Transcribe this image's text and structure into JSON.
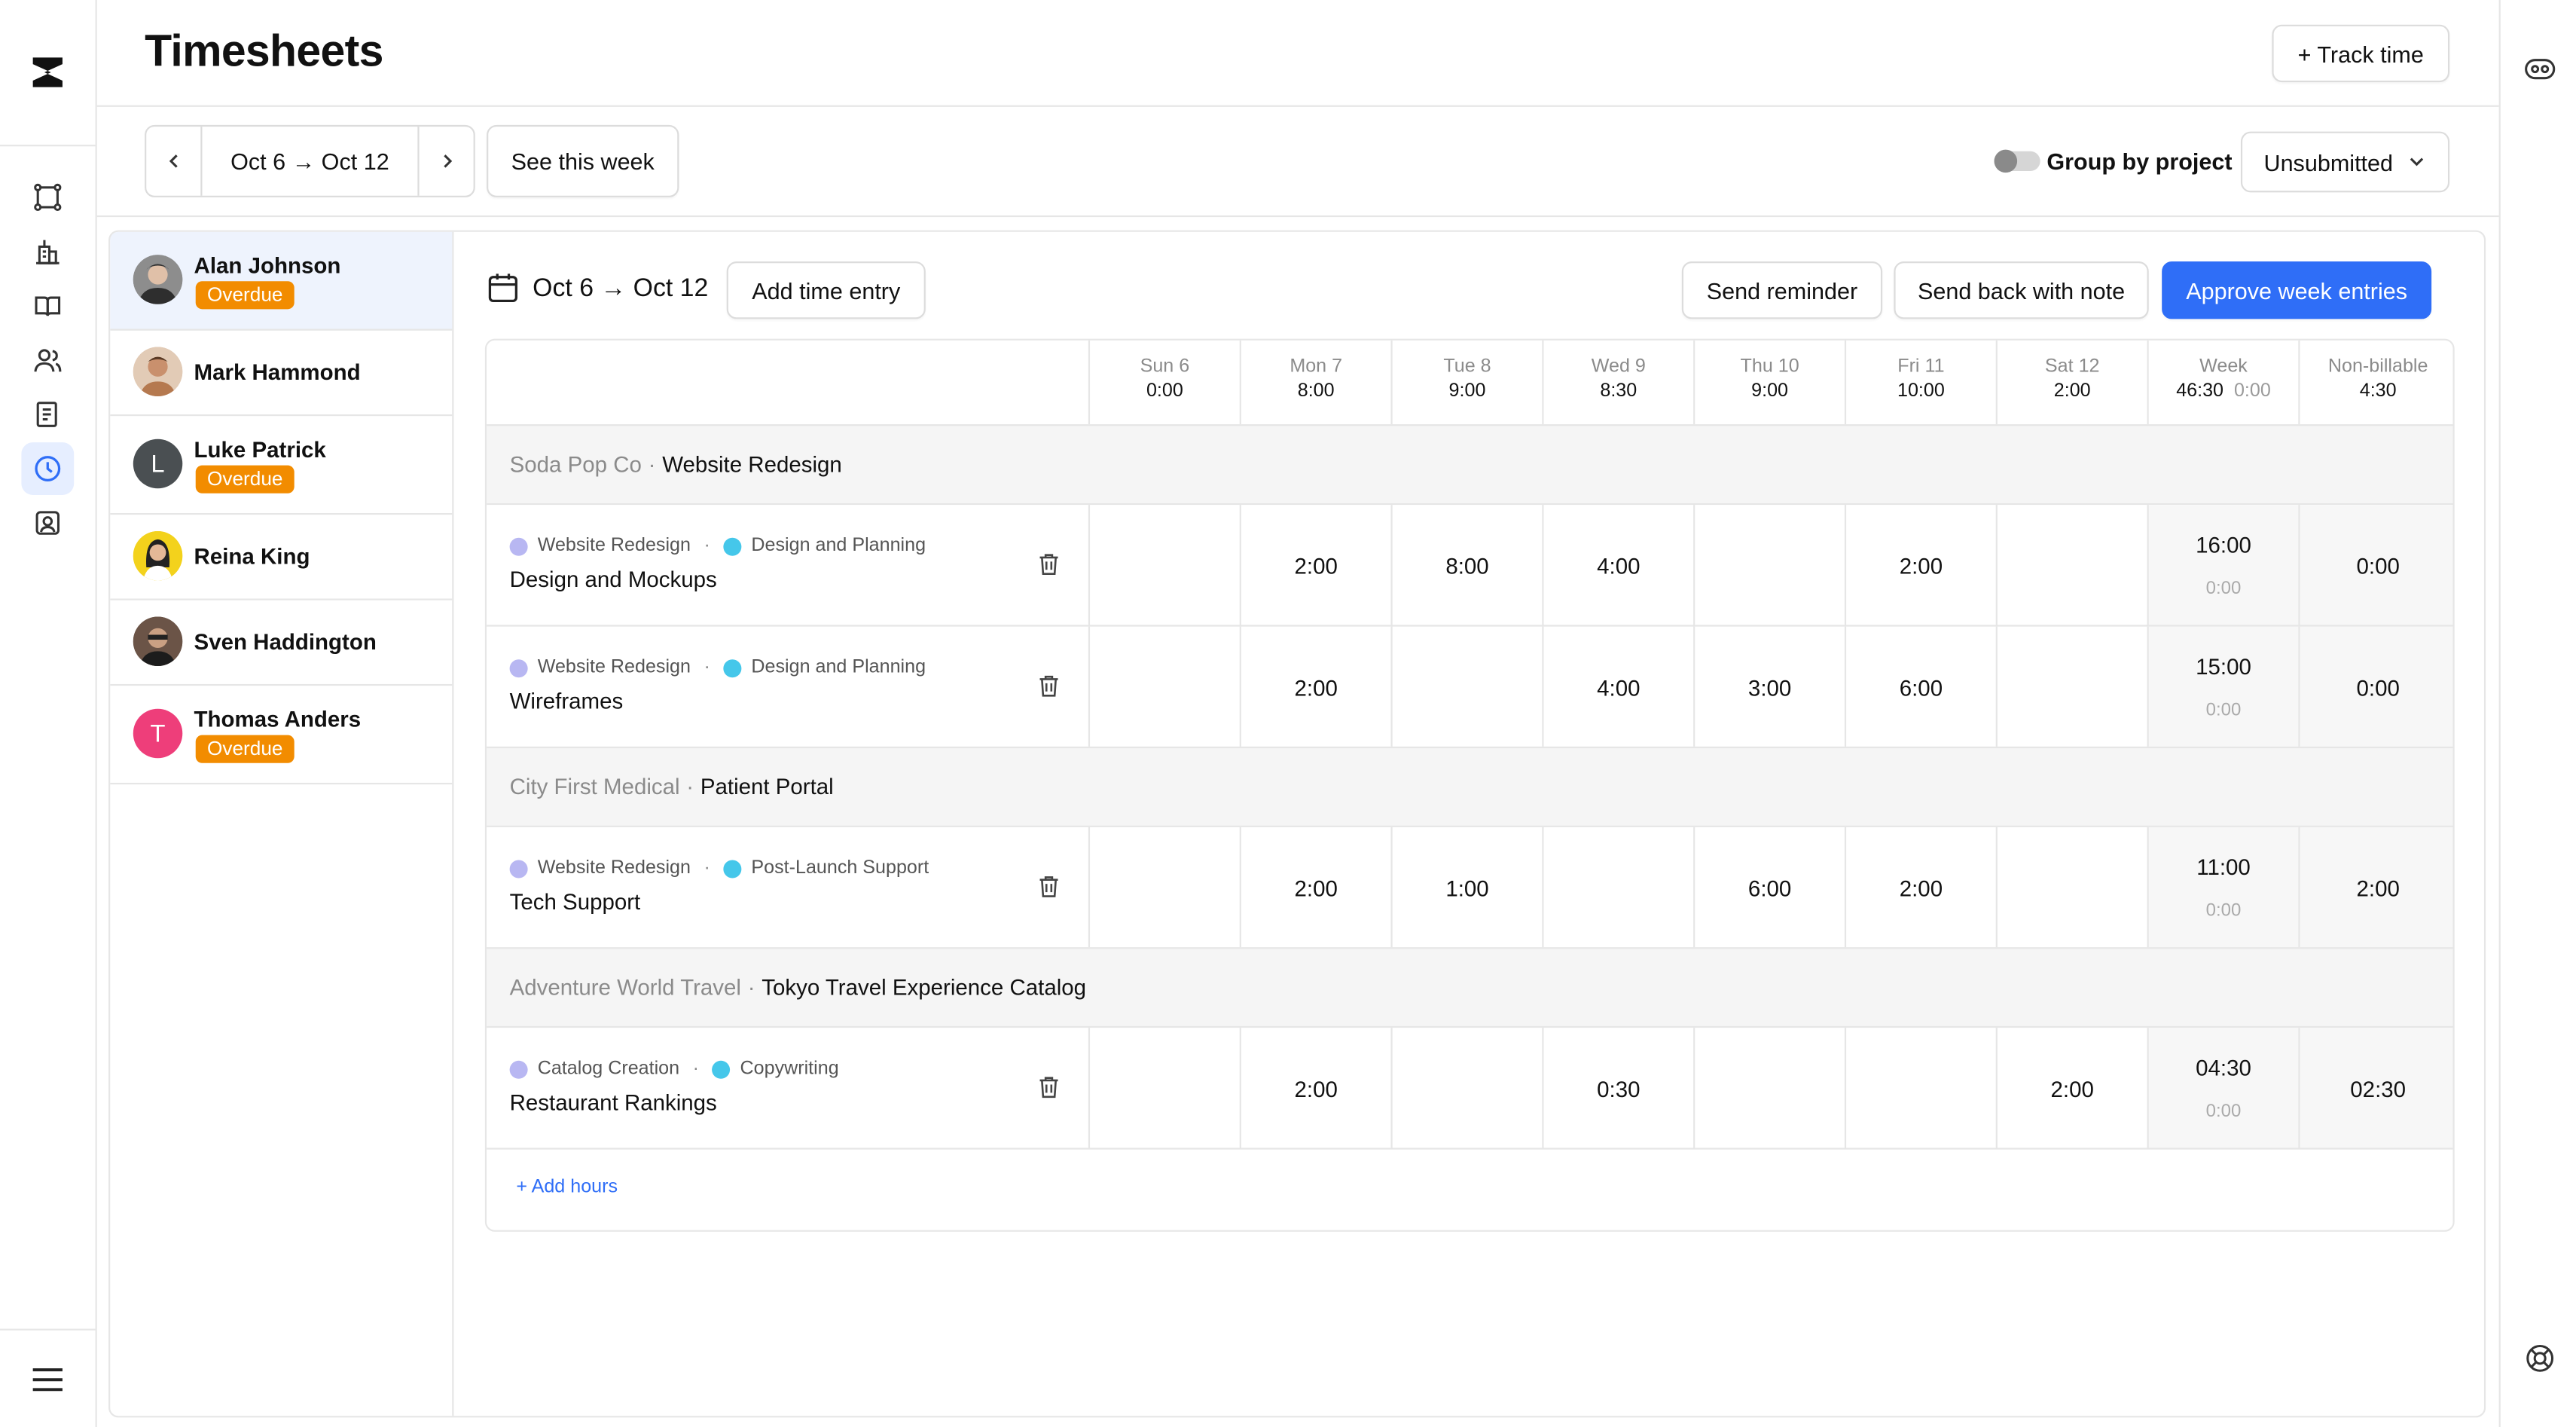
{
  "header": {
    "title": "Timesheets",
    "track_time_label": "+ Track time"
  },
  "filters": {
    "week_range": "Oct 6 → Oct 12",
    "see_this_week_label": "See this week",
    "group_by_project_label": "Group by project",
    "group_by_project_on": false,
    "status_selected": "Unsubmitted"
  },
  "people": [
    {
      "name": "Alan Johnson",
      "badge": "Overdue",
      "selected": true
    },
    {
      "name": "Mark Hammond",
      "badge": ""
    },
    {
      "name": "Luke Patrick",
      "badge": "Overdue",
      "initial": "L"
    },
    {
      "name": "Reina King",
      "badge": ""
    },
    {
      "name": "Sven Haddington",
      "badge": ""
    },
    {
      "name": "Thomas Anders",
      "badge": "Overdue",
      "initial": "T"
    }
  ],
  "panel": {
    "range": "Oct 6 → Oct 12",
    "add_time_entry_label": "Add time entry",
    "send_reminder_label": "Send reminder",
    "send_back_label": "Send back with note",
    "approve_label": "Approve week entries"
  },
  "columns": [
    {
      "day": "Sun 6",
      "total": "0:00"
    },
    {
      "day": "Mon 7",
      "total": "8:00"
    },
    {
      "day": "Tue 8",
      "total": "9:00"
    },
    {
      "day": "Wed 9",
      "total": "8:30"
    },
    {
      "day": "Thu 10",
      "total": "9:00"
    },
    {
      "day": "Fri 11",
      "total": "10:00"
    },
    {
      "day": "Sat 12",
      "total": "2:00"
    }
  ],
  "week_col": {
    "label": "Week",
    "total": "46:30",
    "sub": "0:00"
  },
  "nonbillable_col": {
    "label": "Non-billable",
    "total": "4:30"
  },
  "groups": [
    {
      "client": "Soda Pop Co",
      "separator": "·",
      "project": "Website Redesign",
      "rows": [
        {
          "project": "Website Redesign",
          "category": "Design and Planning",
          "task": "Design and Mockups",
          "hours": [
            "",
            "2:00",
            "8:00",
            "4:00",
            "",
            "2:00",
            ""
          ],
          "week": "16:00",
          "week_sub": "0:00",
          "nonbillable": "0:00"
        },
        {
          "project": "Website Redesign",
          "category": "Design and Planning",
          "task": "Wireframes",
          "hours": [
            "",
            "2:00",
            "",
            "4:00",
            "3:00",
            "6:00",
            ""
          ],
          "week": "15:00",
          "week_sub": "0:00",
          "nonbillable": "0:00"
        }
      ]
    },
    {
      "client": "City First Medical",
      "separator": "·",
      "project": "Patient Portal",
      "rows": [
        {
          "project": "Website Redesign",
          "category": "Post-Launch Support",
          "task": "Tech Support",
          "hours": [
            "",
            "2:00",
            "1:00",
            "",
            "6:00",
            "2:00",
            ""
          ],
          "week": "11:00",
          "week_sub": "0:00",
          "nonbillable": "2:00"
        }
      ]
    },
    {
      "client": "Adventure World Travel",
      "separator": "·",
      "project": "Tokyo Travel Experience Catalog",
      "rows": [
        {
          "project": "Catalog Creation",
          "category": "Copywriting",
          "task": "Restaurant Rankings",
          "hours": [
            "",
            "2:00",
            "",
            "0:30",
            "",
            "",
            "2:00"
          ],
          "week": "04:30",
          "week_sub": "0:00",
          "nonbillable": "02:30"
        }
      ]
    }
  ],
  "meta_separator": "·",
  "add_hours_label": "+ Add hours",
  "colors": {
    "accent": "#2f6ef7",
    "overdue": "#f28c00",
    "project_dot": "#b8b7f2",
    "category_dot": "#45c7ea"
  }
}
